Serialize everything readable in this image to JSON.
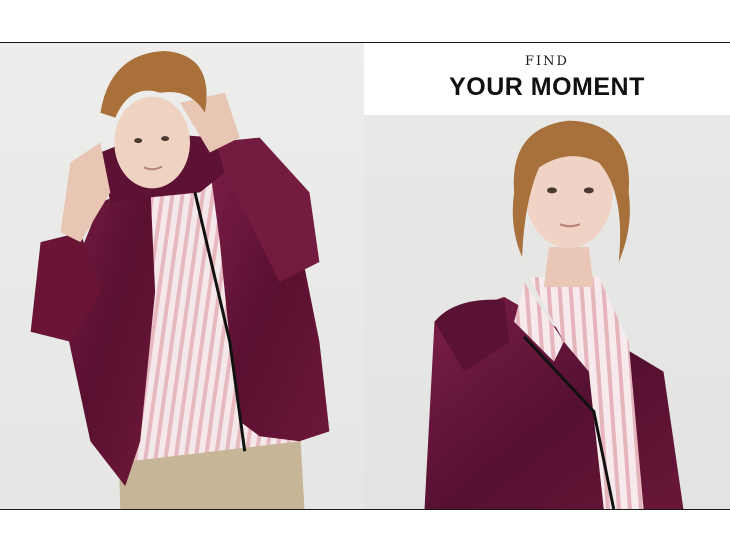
{
  "headline": {
    "small": "FIND",
    "large": "YOUR MOMENT"
  },
  "photos": [
    {
      "subject": "model-left",
      "jacket_color": "#6b1a3a"
    },
    {
      "subject": "model-right",
      "jacket_color": "#6b1a3a"
    }
  ],
  "colors": {
    "background": "#ececeb",
    "frame_border": "#1a1a1a",
    "text": "#111111"
  }
}
